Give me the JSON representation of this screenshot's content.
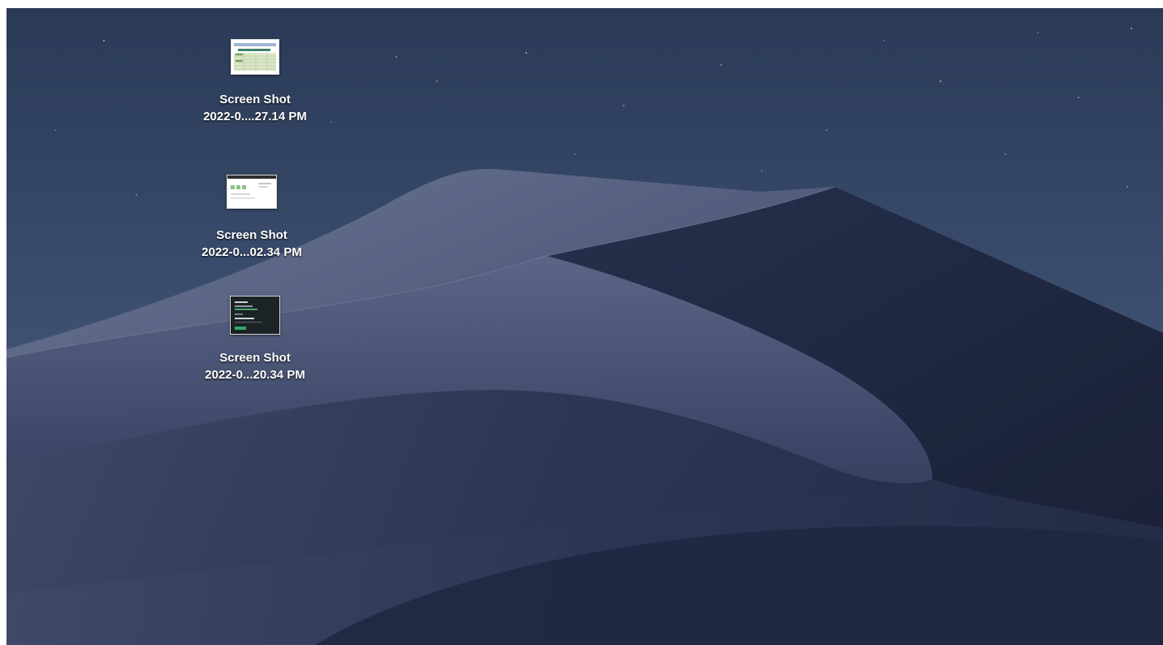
{
  "desktop": {
    "wallpaper": "macos-mojave-night-dunes",
    "colors": {
      "sky_top": "#2e3f5c",
      "sky_bottom": "#4c5f7f",
      "dune_light": "#5a6584",
      "dune_mid": "#3a4463",
      "dune_dark": "#1d2540",
      "label": "#ffffff"
    },
    "icons": [
      {
        "name_line1": "Screen Shot",
        "name_line2": "2022-0....27.14 PM",
        "preview": "spreadsheet-light-preview"
      },
      {
        "name_line1": "Screen Shot",
        "name_line2": "2022-0...02.34 PM",
        "preview": "webpage-light-preview"
      },
      {
        "name_line1": "Screen Shot",
        "name_line2": "2022-0...20.34 PM",
        "preview": "dark-terminal-preview"
      }
    ]
  }
}
